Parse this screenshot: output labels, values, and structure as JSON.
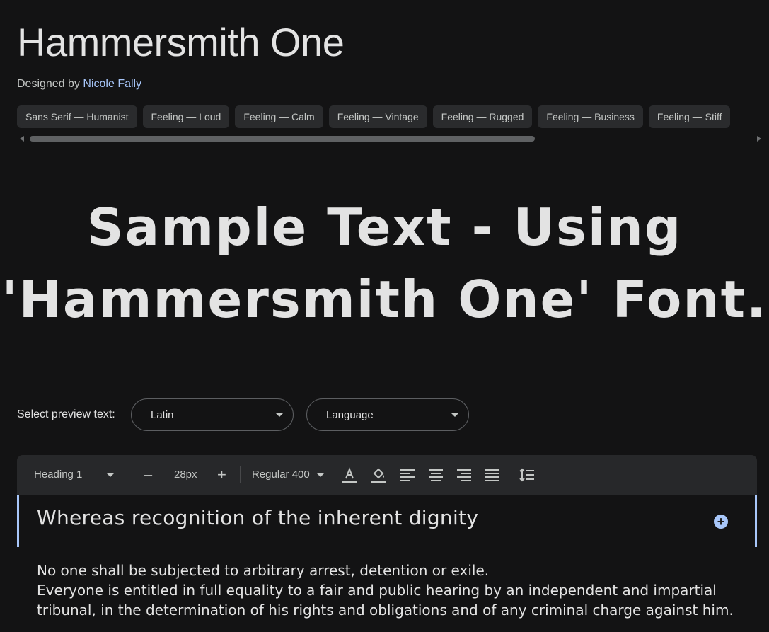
{
  "font": {
    "name": "Hammersmith One",
    "designer_prefix": "Designed by",
    "designer_name": "Nicole Fally"
  },
  "tags": [
    "Sans Serif — Humanist",
    "Feeling — Loud",
    "Feeling — Calm",
    "Feeling — Vintage",
    "Feeling — Rugged",
    "Feeling — Business",
    "Feeling — Stiff"
  ],
  "sample_text": "Sample Text - Using 'Hammersmith One' Font.",
  "preview": {
    "label": "Select preview text:",
    "script_value": "Latin",
    "language_value": "Language"
  },
  "toolbar": {
    "style_value": "Heading 1",
    "decrease": "–",
    "size_value": "28px",
    "increase": "+",
    "weight_value": "Regular 400"
  },
  "editor": {
    "heading": "Whereas recognition of the inherent dignity",
    "paragraphs": [
      "No one shall be subjected to arbitrary arrest, detention or exile.",
      "Everyone is entitled in full equality to a fair and public hearing by an independent and impartial tribunal, in the determination of his rights and obligations and of any criminal charge against him."
    ]
  },
  "colors": {
    "background": "#131314",
    "accent": "#a8c7fa",
    "chip": "#2a2b2d"
  }
}
